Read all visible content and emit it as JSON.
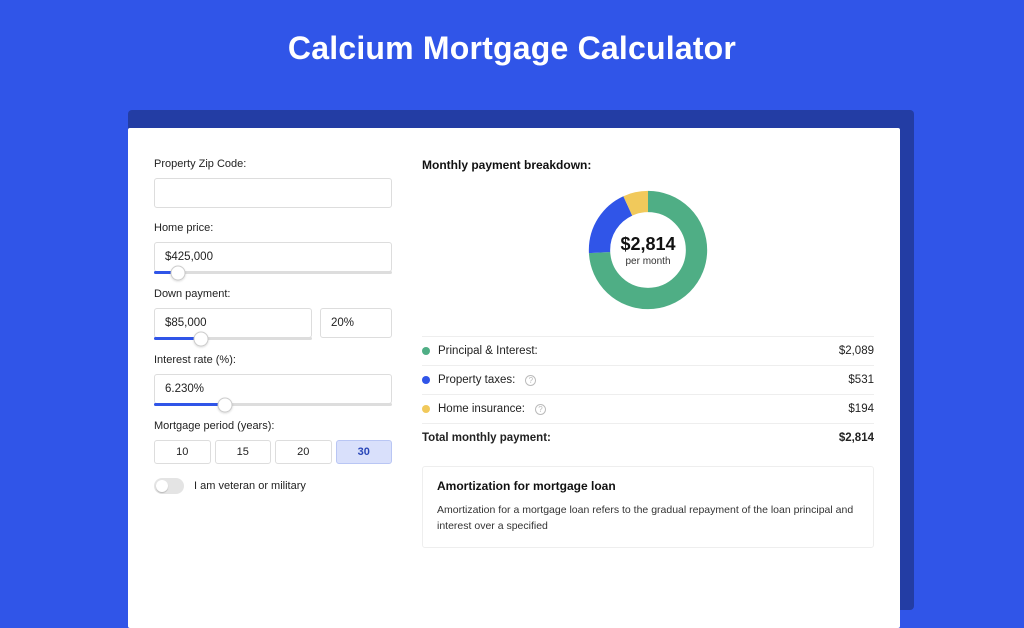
{
  "title": "Calcium Mortgage Calculator",
  "form": {
    "zip_label": "Property Zip Code:",
    "zip_value": "",
    "home_price_label": "Home price:",
    "home_price_value": "$425,000",
    "down_payment_label": "Down payment:",
    "down_payment_amount": "$85,000",
    "down_payment_pct": "20%",
    "interest_label": "Interest rate (%):",
    "interest_value": "6.230%",
    "period_label": "Mortgage period (years):",
    "period_options": [
      "10",
      "15",
      "20",
      "30"
    ],
    "period_selected": "30",
    "veteran_label": "I am veteran or military"
  },
  "breakdown": {
    "title": "Monthly payment breakdown:",
    "center_amount": "$2,814",
    "center_sub": "per month",
    "items": [
      {
        "label": "Principal & Interest:",
        "value": "$2,089",
        "color": "#4fae85",
        "info": false,
        "pct": 74
      },
      {
        "label": "Property taxes:",
        "value": "$531",
        "color": "#3055e8",
        "info": true,
        "pct": 19
      },
      {
        "label": "Home insurance:",
        "value": "$194",
        "color": "#f1c95b",
        "info": true,
        "pct": 7
      }
    ],
    "total_label": "Total monthly payment:",
    "total_value": "$2,814"
  },
  "amortization": {
    "title": "Amortization for mortgage loan",
    "text": "Amortization for a mortgage loan refers to the gradual repayment of the loan principal and interest over a specified"
  },
  "chart_data": {
    "type": "pie",
    "title": "Monthly payment breakdown",
    "series": [
      {
        "name": "Principal & Interest",
        "value": 2089
      },
      {
        "name": "Property taxes",
        "value": 531
      },
      {
        "name": "Home insurance",
        "value": 194
      }
    ],
    "total": 2814,
    "unit": "USD per month"
  }
}
